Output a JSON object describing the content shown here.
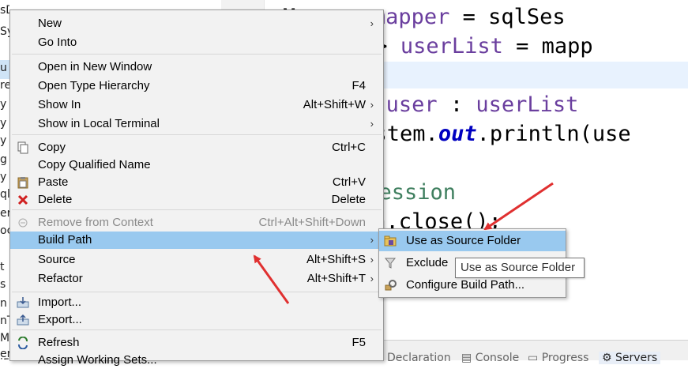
{
  "left_panel": {
    "fragments": [
      "sD",
      "Sy",
      "u",
      "re",
      "y",
      "y",
      "y",
      "g",
      "y",
      "ql",
      "er",
      "oc",
      "t",
      "s",
      "n",
      "nT",
      "M",
      "er",
      "i5"
    ]
  },
  "editor": {
    "lines": [
      {
        "parts": [
          {
            "t": "UserMapper ",
            "c": "type"
          },
          {
            "t": "mapper",
            "c": "var"
          },
          {
            "t": " = sqlSes",
            "c": "type"
          }
        ]
      },
      {
        "parts": [
          {
            "t": "List<User> ",
            "c": "type"
          },
          {
            "t": "userList",
            "c": "var"
          },
          {
            "t": " = mapp",
            "c": "type"
          }
        ]
      },
      {
        "parts": []
      },
      {
        "parts": [
          {
            "t": "for",
            "c": "kw"
          },
          {
            "t": " (User ",
            "c": "type"
          },
          {
            "t": "user",
            "c": "var"
          },
          {
            "t": " : ",
            "c": "type"
          },
          {
            "t": "userList",
            "c": "var"
          }
        ]
      },
      {
        "parts": [
          {
            "t": "    System.",
            "c": "type"
          },
          {
            "t": "out",
            "c": "fld"
          },
          {
            "t": ".println(use",
            "c": "type"
          }
        ]
      },
      {
        "parts": []
      },
      {
        "parts": [
          {
            "t": "//关闭sqlSession",
            "c": "cmt"
          }
        ]
      },
      {
        "parts": [
          {
            "t": "sqlSession.close();",
            "c": "type"
          }
        ]
      }
    ]
  },
  "context_menu": {
    "items": [
      {
        "label": "New",
        "shortcut": "",
        "submenu": true,
        "icon": ""
      },
      {
        "label": "Go Into",
        "shortcut": "",
        "icon": ""
      },
      {
        "label": "Open in New Window",
        "shortcut": "",
        "icon": ""
      },
      {
        "label": "Open Type Hierarchy",
        "shortcut": "F4",
        "icon": ""
      },
      {
        "label": "Show In",
        "shortcut": "Alt+Shift+W",
        "submenu": true,
        "icon": ""
      },
      {
        "label": "Show in Local Terminal",
        "shortcut": "",
        "submenu": true,
        "icon": ""
      },
      {
        "label": "Copy",
        "shortcut": "Ctrl+C",
        "icon": "copy-icon"
      },
      {
        "label": "Copy Qualified Name",
        "shortcut": "",
        "icon": ""
      },
      {
        "label": "Paste",
        "shortcut": "Ctrl+V",
        "icon": "paste-icon"
      },
      {
        "label": "Delete",
        "shortcut": "Delete",
        "icon": "delete-icon"
      },
      {
        "label": "Remove from Context",
        "shortcut": "Ctrl+Alt+Shift+Down",
        "disabled": true,
        "icon": "remove-context-icon"
      },
      {
        "label": "Build Path",
        "shortcut": "",
        "submenu": true,
        "highlighted": true,
        "icon": ""
      },
      {
        "label": "Source",
        "shortcut": "Alt+Shift+S",
        "submenu": true,
        "icon": ""
      },
      {
        "label": "Refactor",
        "shortcut": "Alt+Shift+T",
        "submenu": true,
        "icon": ""
      },
      {
        "label": "Import...",
        "shortcut": "",
        "icon": "import-icon"
      },
      {
        "label": "Export...",
        "shortcut": "",
        "icon": "export-icon"
      },
      {
        "label": "Refresh",
        "shortcut": "F5",
        "icon": "refresh-icon"
      },
      {
        "label": "Assign Working Sets...",
        "shortcut": "",
        "icon": ""
      }
    ]
  },
  "submenu": {
    "items": [
      {
        "label": "Use as Source Folder",
        "icon": "source-folder-icon",
        "highlighted": true
      },
      {
        "label": "Exclude",
        "icon": "filter-icon"
      },
      {
        "label": "Configure Build Path...",
        "icon": "build-path-icon"
      }
    ]
  },
  "tooltip": {
    "text": "Use as Source Folder"
  },
  "bottom_tabs": [
    "Declaration",
    "Console",
    "Progress",
    "Servers"
  ],
  "colors": {
    "menu_bg": "#f2f2f2",
    "menu_highlight": "#99c9ef",
    "annotation_arrow": "#e03030",
    "keyword": "#7f0055",
    "variable": "#6a3e9e",
    "field": "#0000c0",
    "comment": "#3f7f5f"
  }
}
